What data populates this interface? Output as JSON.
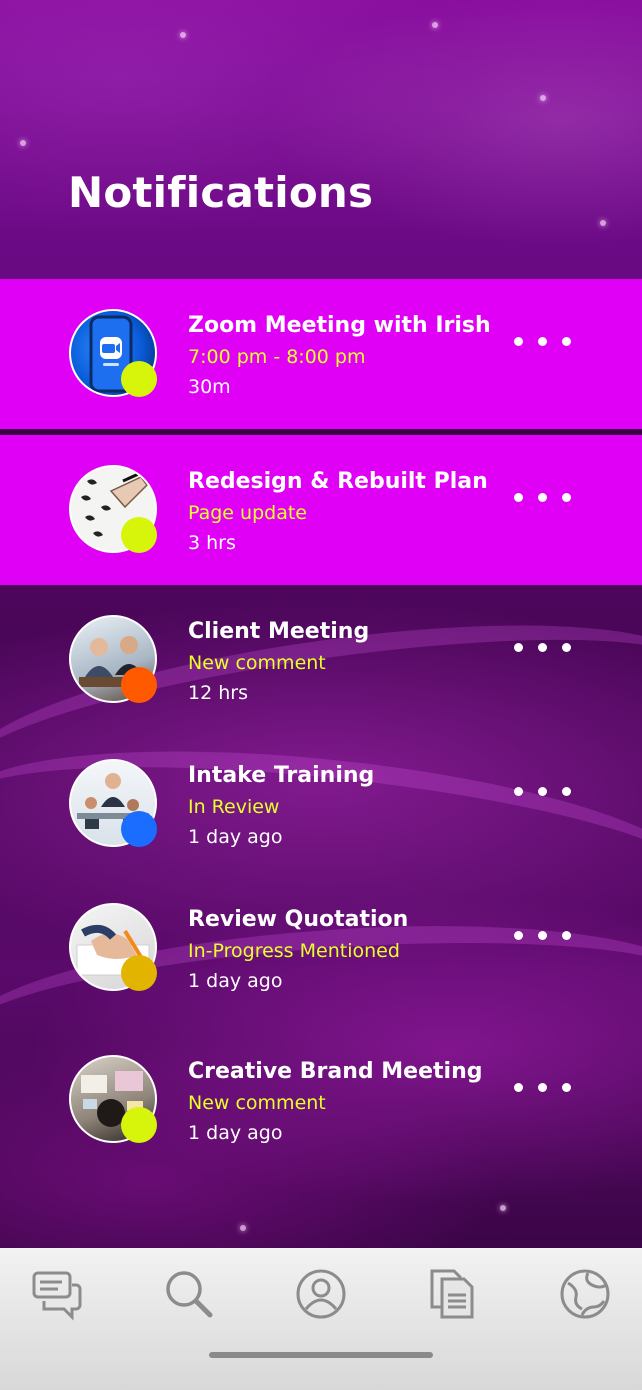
{
  "header": {
    "title": "Notifications"
  },
  "notifications": [
    {
      "title": "Zoom Meeting with Irish",
      "subtitle": "7:00 pm - 8:00 pm",
      "time": "30m",
      "status_color": "#d7f50a",
      "avatar_icon": "zoom-app-icon",
      "highlighted": true
    },
    {
      "title": "Redesign & Rebuilt Plan",
      "subtitle": "Page update",
      "time": "3 hrs",
      "status_color": "#d7f50a",
      "avatar_icon": "sketching-hand-icon",
      "highlighted": true
    },
    {
      "title": "Client Meeting",
      "subtitle": "New comment",
      "time": "12 hrs",
      "status_color": "#ff5a00",
      "avatar_icon": "people-meeting-icon",
      "highlighted": false
    },
    {
      "title": "Intake Training",
      "subtitle": "In Review",
      "time": "1 day ago",
      "status_color": "#1a6dff",
      "avatar_icon": "call-center-icon",
      "highlighted": false
    },
    {
      "title": "Review Quotation",
      "subtitle": "In-Progress Mentioned",
      "time": "1 day ago",
      "status_color": "#e2b400",
      "avatar_icon": "writing-hand-icon",
      "highlighted": false
    },
    {
      "title": "Creative Brand Meeting",
      "subtitle": "New comment",
      "time": "1 day ago",
      "status_color": "#d7f50a",
      "avatar_icon": "desk-workspace-icon",
      "highlighted": false
    }
  ],
  "tabbar": {
    "tabs": [
      {
        "name": "chat-icon"
      },
      {
        "name": "search-icon"
      },
      {
        "name": "profile-icon"
      },
      {
        "name": "documents-icon"
      },
      {
        "name": "globe-icon"
      }
    ]
  },
  "colors": {
    "highlight": "#e000f5",
    "accent_text": "#e9ff2a",
    "tab_icon": "#8c8c8c"
  }
}
